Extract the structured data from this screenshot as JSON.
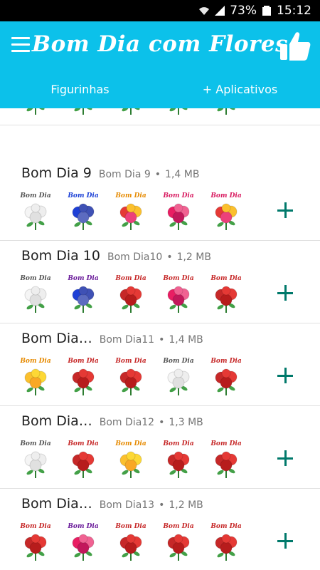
{
  "status": {
    "battery": "73%",
    "time": "15:12"
  },
  "app": {
    "title": "Bom Dia com Flores"
  },
  "tabs": [
    {
      "label": "Figurinhas"
    },
    {
      "label": "+ Aplicativos"
    }
  ],
  "sticker_caption": "Bom Dia",
  "packs": [
    {
      "name": "",
      "publisher": "",
      "size": "",
      "stickers": [
        {
          "caption_color": "#c62828",
          "flower": "red"
        },
        {
          "caption_color": "#c62828",
          "flower": "orange"
        },
        {
          "caption_color": "#e68a00",
          "flower": "mixed"
        },
        {
          "caption_color": "#e68a00",
          "flower": "yellow"
        },
        {
          "caption_color": "#c62828",
          "flower": "red"
        }
      ]
    },
    {
      "name": "Bom Dia 9",
      "publisher": "Bom Dia 9",
      "size": "1,4 MB",
      "stickers": [
        {
          "caption_color": "#555555",
          "flower": "white"
        },
        {
          "caption_color": "#1a3fd6",
          "flower": "blue"
        },
        {
          "caption_color": "#e68a00",
          "flower": "mixed"
        },
        {
          "caption_color": "#d81b60",
          "flower": "pink"
        },
        {
          "caption_color": "#d81b60",
          "flower": "mixed"
        }
      ]
    },
    {
      "name": "Bom Dia 10",
      "publisher": "Bom Dia10",
      "size": "1,2 MB",
      "stickers": [
        {
          "caption_color": "#555555",
          "flower": "white"
        },
        {
          "caption_color": "#6a1b9a",
          "flower": "blue"
        },
        {
          "caption_color": "#c62828",
          "flower": "red"
        },
        {
          "caption_color": "#c62828",
          "flower": "pink"
        },
        {
          "caption_color": "#c62828",
          "flower": "red"
        }
      ]
    },
    {
      "name": "Bom Dia…",
      "publisher": "Bom Dia11",
      "size": "1,4 MB",
      "stickers": [
        {
          "caption_color": "#e68a00",
          "flower": "yellow"
        },
        {
          "caption_color": "#c62828",
          "flower": "red"
        },
        {
          "caption_color": "#c62828",
          "flower": "red"
        },
        {
          "caption_color": "#555555",
          "flower": "white"
        },
        {
          "caption_color": "#c62828",
          "flower": "red"
        }
      ]
    },
    {
      "name": "Bom Dia…",
      "publisher": "Bom Dia12",
      "size": "1,3 MB",
      "stickers": [
        {
          "caption_color": "#555555",
          "flower": "white"
        },
        {
          "caption_color": "#c62828",
          "flower": "red"
        },
        {
          "caption_color": "#e68a00",
          "flower": "yellow"
        },
        {
          "caption_color": "#c62828",
          "flower": "red"
        },
        {
          "caption_color": "#c62828",
          "flower": "red"
        }
      ]
    },
    {
      "name": "Bom Dia…",
      "publisher": "Bom Dia13",
      "size": "1,2 MB",
      "stickers": [
        {
          "caption_color": "#c62828",
          "flower": "red"
        },
        {
          "caption_color": "#6a1b9a",
          "flower": "pink"
        },
        {
          "caption_color": "#c62828",
          "flower": "red"
        },
        {
          "caption_color": "#c62828",
          "flower": "red"
        },
        {
          "caption_color": "#c62828",
          "flower": "red"
        }
      ]
    }
  ],
  "colors": {
    "appbar": "#0cc1ea",
    "add_icon": "#00796b",
    "divider": "#e0e0e0"
  },
  "icons": {
    "menu": "menu-icon",
    "like": "thumbs-up-icon",
    "add": "plus-icon",
    "wifi": "wifi-icon",
    "signal": "signal-icon",
    "battery": "battery-icon"
  }
}
